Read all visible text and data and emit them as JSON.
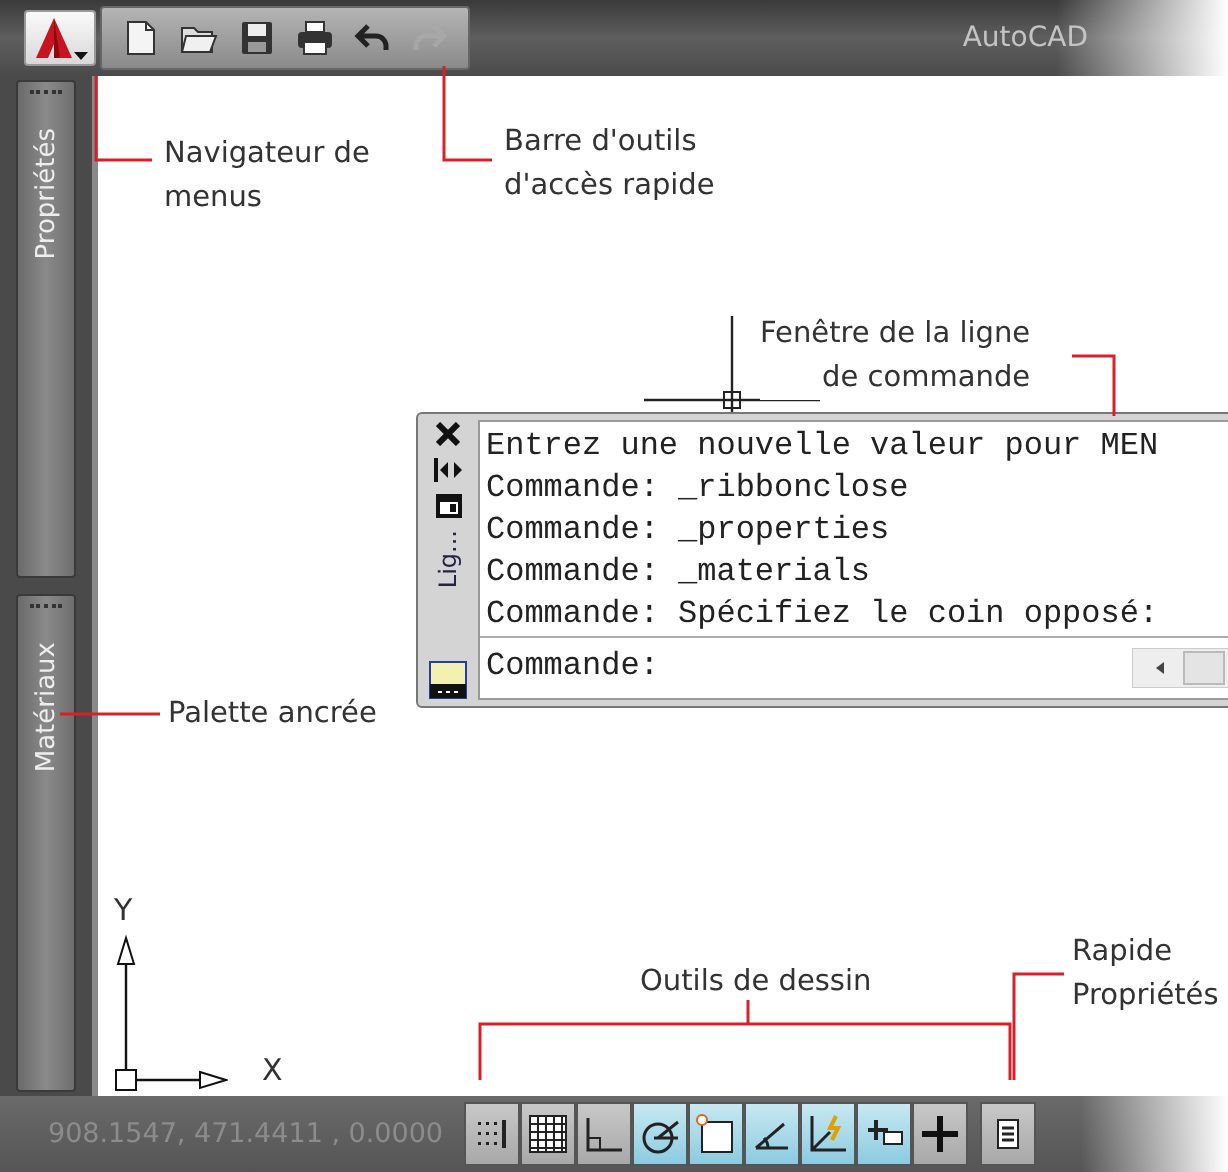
{
  "title_bar": {
    "quick_access": [
      {
        "kind": "new",
        "disabled": false
      },
      {
        "kind": "open",
        "disabled": false
      },
      {
        "kind": "save",
        "disabled": false
      },
      {
        "kind": "print",
        "disabled": false
      },
      {
        "kind": "undo",
        "disabled": false
      },
      {
        "kind": "redo",
        "disabled": true
      }
    ],
    "title": "AutoCAD"
  },
  "palettes": [
    {
      "label": "Propriétés"
    },
    {
      "label": "Matériaux"
    }
  ],
  "command_window": {
    "side_label": "Lig...",
    "history": [
      "Entrez une nouvelle valeur pour MEN",
      "Commande: _ribbonclose",
      "Commande: _properties",
      "Commande: _materials",
      "Commande: Spécifiez le coin opposé:"
    ],
    "prompt": "Commande:"
  },
  "ucs_icon": {
    "y_label": "Y",
    "x_label": "X"
  },
  "status_bar": {
    "coordinates": "908.1547, 471.4411 , 0.0000",
    "toggles": [
      {
        "kind": "snap",
        "on": false
      },
      {
        "kind": "grid",
        "on": false
      },
      {
        "kind": "ortho",
        "on": false
      },
      {
        "kind": "polar",
        "on": true
      },
      {
        "kind": "osnap",
        "on": true
      },
      {
        "kind": "otrack",
        "on": true
      },
      {
        "kind": "ducs",
        "on": true
      },
      {
        "kind": "dyn",
        "on": true
      },
      {
        "kind": "lwt",
        "on": false
      },
      {
        "kind": "qp",
        "on": false
      }
    ]
  },
  "annotations": [
    {
      "text": "Navigateur de\nmenus"
    },
    {
      "text": "Barre d'outils\nd'accès rapide"
    },
    {
      "text": "Fenêtre de la ligne\nde commande"
    },
    {
      "text": "Palette ancrée"
    },
    {
      "text": "Outils de dessin"
    },
    {
      "text": "Rapide\nPropriétés"
    }
  ]
}
